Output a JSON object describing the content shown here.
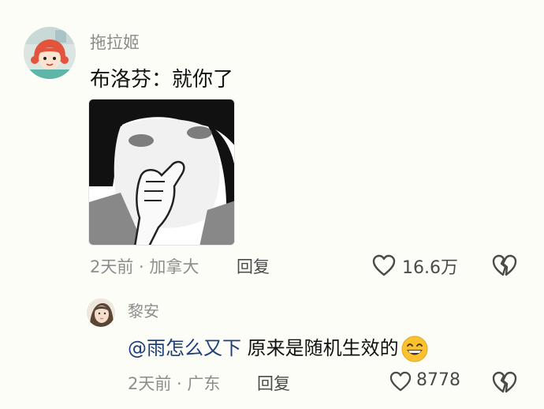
{
  "comments": [
    {
      "avatar_icon": "cartoon-girl-avatar",
      "username": "拖拉姬",
      "text": "布洛芬：就你了",
      "sticker_icon": "meme-pointing-finger-sticker",
      "meta": "2天前 · 加拿大",
      "reply_label": "回复",
      "likes": "16.6万"
    }
  ],
  "reply": {
    "avatar_icon": "girl-photo-avatar",
    "username": "黎安",
    "mention": "@雨怎么又下",
    "text": " 原来是随机生效的",
    "emoji_icon": "grinning-face-emoji",
    "meta": "2天前 · 广东",
    "reply_label": "回复",
    "likes": "8778"
  },
  "icons": {
    "like": "heart-outline-icon",
    "dislike": "broken-heart-icon"
  },
  "colors": {
    "background": "#fdfdf8",
    "secondary_text": "#8d8d8d",
    "mention": "#1d3f7a"
  }
}
